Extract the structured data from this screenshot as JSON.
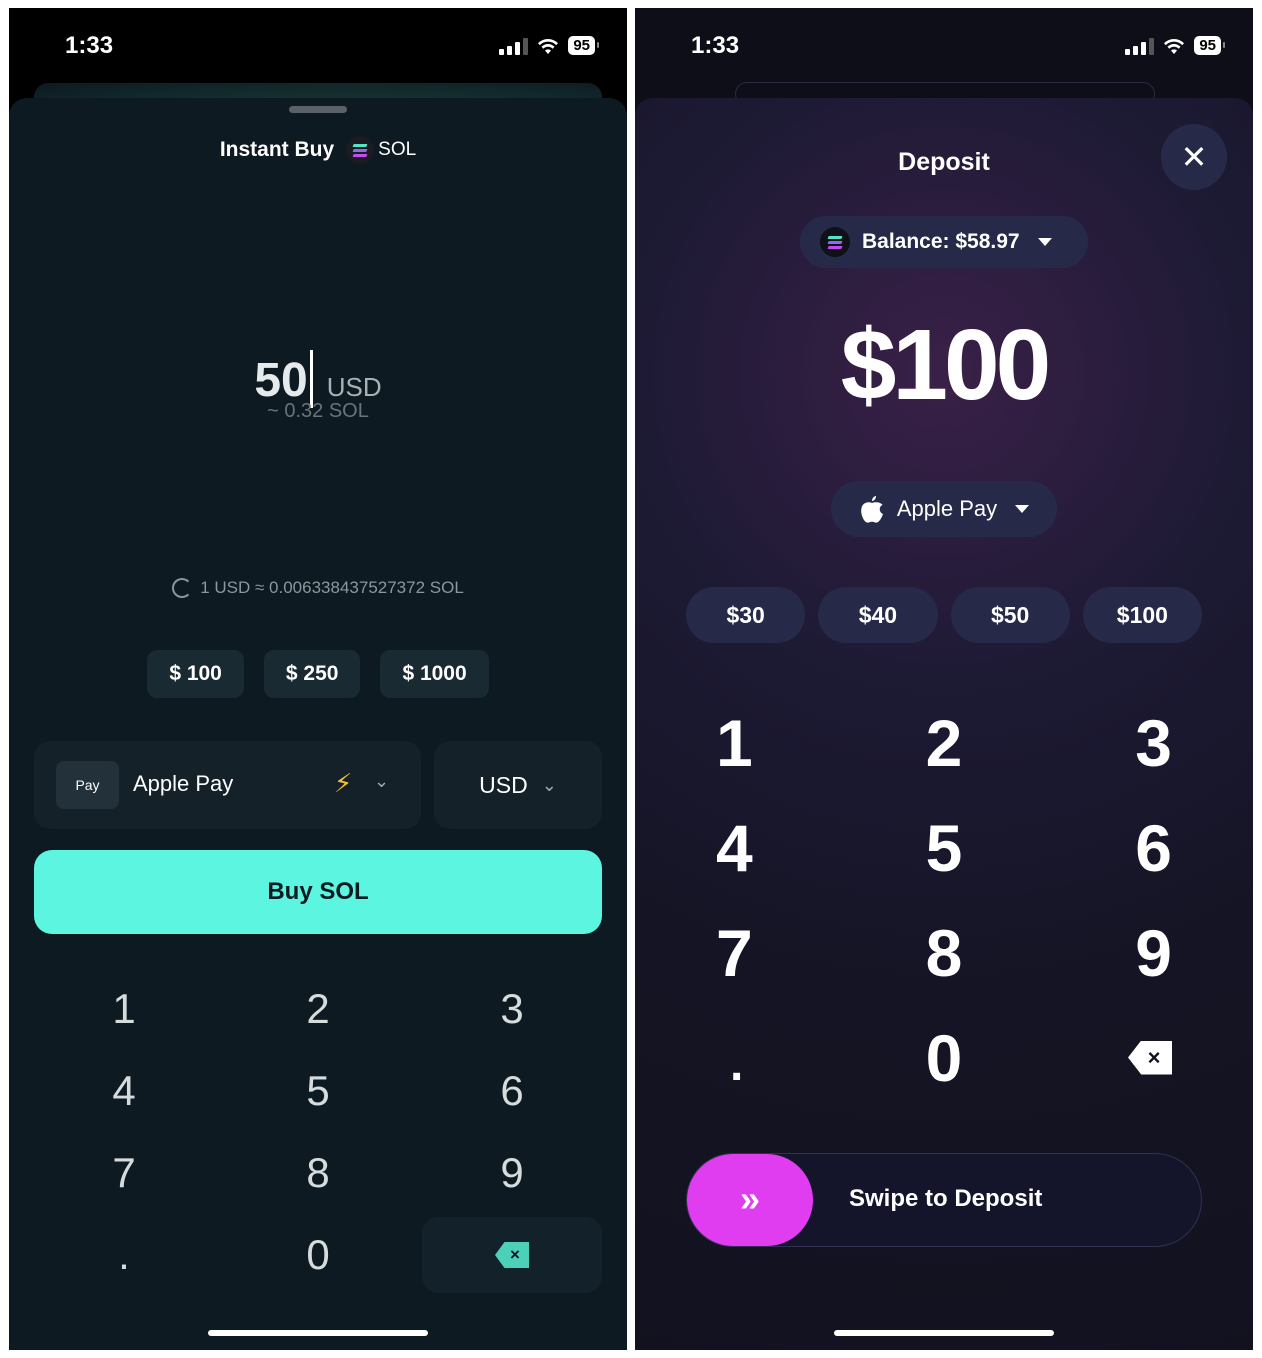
{
  "left": {
    "status": {
      "time": "1:33",
      "battery": "95"
    },
    "title": "Instant Buy",
    "token": "SOL",
    "amount": "50",
    "amount_unit": "USD",
    "estimate": "~ 0.32 SOL",
    "rate": "1 USD ≈ 0.006338437527372 SOL",
    "presets": [
      "$ 100",
      "$ 250",
      "$ 1000"
    ],
    "payment": {
      "badge": "Pay",
      "name": "Apple Pay",
      "bolt": "⚡",
      "chevron": "⌄"
    },
    "currency": "USD",
    "buy_label": "Buy SOL",
    "keys": [
      "1",
      "2",
      "3",
      "4",
      "5",
      "6",
      "7",
      "8",
      "9",
      ".",
      "0"
    ],
    "backspace_glyph": "×",
    "colors": {
      "accent": "#5cf5e0",
      "background": "#0d1a22"
    }
  },
  "right": {
    "status": {
      "time": "1:33",
      "battery": "95"
    },
    "title": "Deposit",
    "close_glyph": "✕",
    "balance": "Balance: $58.97",
    "amount": "$100",
    "payment": {
      "icon": "",
      "name": "Apple Pay"
    },
    "presets": [
      "$30",
      "$40",
      "$50",
      "$100"
    ],
    "keys": [
      "1",
      "2",
      "3",
      "4",
      "5",
      "6",
      "7",
      "8",
      "9",
      ".",
      "0"
    ],
    "backspace_glyph": "×",
    "swipe": {
      "knob": "»",
      "label": "Swipe to Deposit"
    },
    "colors": {
      "accent": "#e03df0",
      "background": "#12121f"
    }
  }
}
